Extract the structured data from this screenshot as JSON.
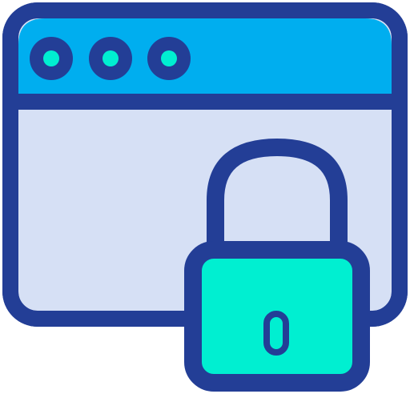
{
  "icon": {
    "name": "secure-browser-window-lock-icon",
    "colors": {
      "outline": "#233E96",
      "title_bar": "#00AEEF",
      "window_body": "#D6E0F5",
      "accent": "#00EFD1",
      "dot_fill": "#00EFD1",
      "background": "#FFFFFF"
    },
    "window_dots": 3
  }
}
